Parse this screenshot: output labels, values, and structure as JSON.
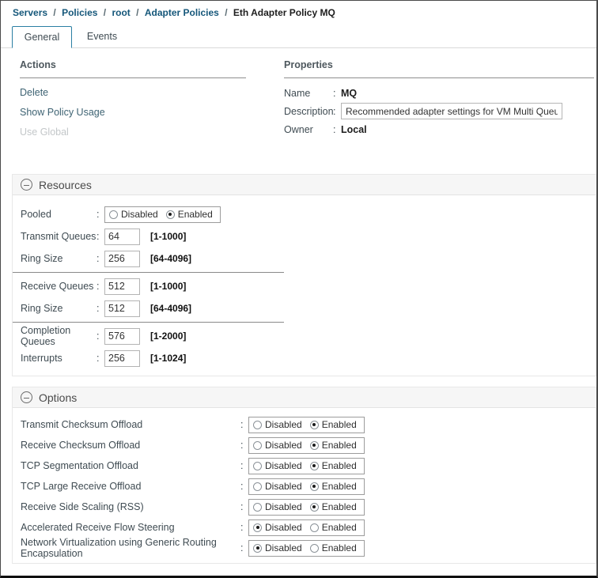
{
  "breadcrumb": {
    "separator": "/",
    "links": [
      {
        "label": "Servers"
      },
      {
        "label": "Policies"
      },
      {
        "label": "root"
      },
      {
        "label": "Adapter Policies"
      }
    ],
    "current": "Eth Adapter Policy MQ"
  },
  "tabs": {
    "general": "General",
    "events": "Events"
  },
  "actions": {
    "title": "Actions",
    "delete": "Delete",
    "show_policy_usage": "Show Policy Usage",
    "use_global": "Use Global"
  },
  "properties": {
    "title": "Properties",
    "colon": ":",
    "name": {
      "label": "Name",
      "value": "MQ"
    },
    "description": {
      "label": "Description",
      "value": "Recommended adapter settings for VM Multi Queue"
    },
    "owner": {
      "label": "Owner",
      "value": "Local"
    }
  },
  "resources": {
    "title": "Resources",
    "colon": ":",
    "pooled": {
      "label": "Pooled",
      "options": [
        "Disabled",
        "Enabled"
      ],
      "selected": "Enabled"
    },
    "transmit_queues": {
      "label": "Transmit Queues",
      "value": "64",
      "range": "[1-1000]"
    },
    "ring_size_1": {
      "label": "Ring Size",
      "value": "256",
      "range": "[64-4096]"
    },
    "receive_queues": {
      "label": "Receive Queues",
      "value": "512",
      "range": "[1-1000]"
    },
    "ring_size_2": {
      "label": "Ring Size",
      "value": "512",
      "range": "[64-4096]"
    },
    "completion_queues": {
      "label": "Completion Queues",
      "value": "576",
      "range": "[1-2000]"
    },
    "interrupts": {
      "label": "Interrupts",
      "value": "256",
      "range": "[1-1024]"
    }
  },
  "options": {
    "title": "Options",
    "colon": ":",
    "rows": [
      {
        "label": "Transmit Checksum Offload",
        "options": [
          "Disabled",
          "Enabled"
        ],
        "selected": "Enabled"
      },
      {
        "label": "Receive Checksum Offload",
        "options": [
          "Disabled",
          "Enabled"
        ],
        "selected": "Enabled"
      },
      {
        "label": "TCP Segmentation Offload",
        "options": [
          "Disabled",
          "Enabled"
        ],
        "selected": "Enabled"
      },
      {
        "label": "TCP Large Receive Offload",
        "options": [
          "Disabled",
          "Enabled"
        ],
        "selected": "Enabled"
      },
      {
        "label": "Receive Side Scaling (RSS)",
        "options": [
          "Disabled",
          "Enabled"
        ],
        "selected": "Enabled"
      },
      {
        "label": "Accelerated Receive Flow Steering",
        "options": [
          "Disabled",
          "Enabled"
        ],
        "selected": "Disabled"
      },
      {
        "label": "Network Virtualization using Generic Routing Encapsulation",
        "options": [
          "Disabled",
          "Enabled"
        ],
        "selected": "Disabled"
      }
    ]
  },
  "colors": {
    "breadcrumb_link": "#15577a",
    "action_link": "#3e6373",
    "disabled_link": "#c3c7c9",
    "active_tab_border": "#2b7fa3",
    "panel_header_bg": "#f6f6f6"
  }
}
